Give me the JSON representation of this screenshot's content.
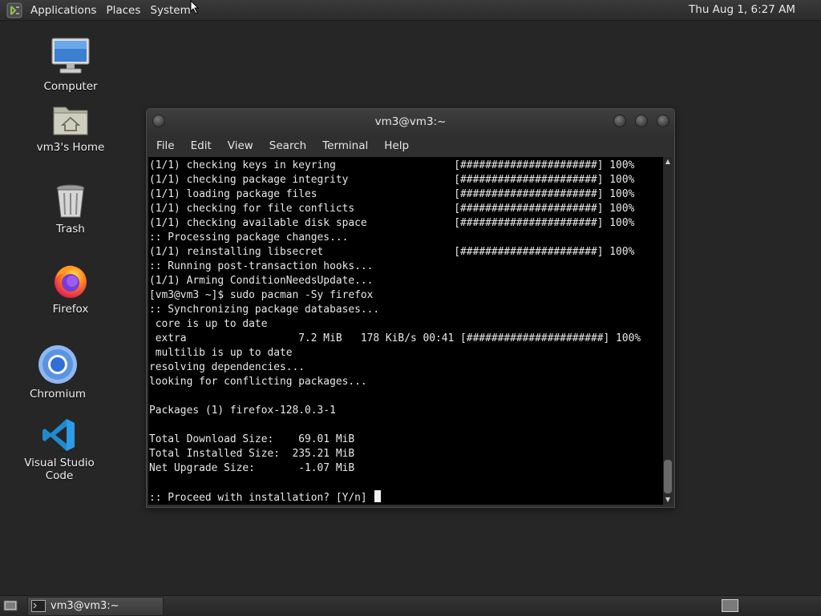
{
  "top_panel": {
    "menus": [
      "Applications",
      "Places",
      "System"
    ],
    "clock": "Thu Aug  1,  6:27 AM"
  },
  "desktop": {
    "icons": [
      {
        "label": "Computer",
        "icon": "computer-icon"
      },
      {
        "label": "vm3's Home",
        "icon": "home-folder-icon"
      },
      {
        "label": "Trash",
        "icon": "trash-icon"
      },
      {
        "label": "Firefox",
        "icon": "firefox-icon"
      },
      {
        "label": "Chromium",
        "icon": "chromium-icon"
      },
      {
        "label": "Visual Studio Code",
        "icon": "vscode-icon"
      }
    ]
  },
  "terminal": {
    "title": "vm3@vm3:~",
    "menu": [
      "File",
      "Edit",
      "View",
      "Search",
      "Terminal",
      "Help"
    ],
    "lines": [
      "(1/1) checking keys in keyring                   [######################] 100%",
      "(1/1) checking package integrity                 [######################] 100%",
      "(1/1) loading package files                      [######################] 100%",
      "(1/1) checking for file conflicts                [######################] 100%",
      "(1/1) checking available disk space              [######################] 100%",
      ":: Processing package changes...",
      "(1/1) reinstalling libsecret                     [######################] 100%",
      ":: Running post-transaction hooks...",
      "(1/1) Arming ConditionNeedsUpdate...",
      "[vm3@vm3 ~]$ sudo pacman -Sy firefox",
      ":: Synchronizing package databases...",
      " core is up to date",
      " extra                  7.2 MiB   178 KiB/s 00:41 [######################] 100%",
      " multilib is up to date",
      "resolving dependencies...",
      "looking for conflicting packages...",
      "",
      "Packages (1) firefox-128.0.3-1",
      "",
      "Total Download Size:    69.01 MiB",
      "Total Installed Size:  235.21 MiB",
      "Net Upgrade Size:       -1.07 MiB",
      "",
      ":: Proceed with installation? [Y/n] "
    ]
  },
  "taskbar": {
    "tasks": [
      {
        "label": "vm3@vm3:~"
      }
    ]
  },
  "colors": {
    "desktop_bg": "#262626",
    "terminal_bg": "#000000",
    "terminal_fg": "#e8e8e8",
    "panel_bg": "#2f2f2f"
  }
}
